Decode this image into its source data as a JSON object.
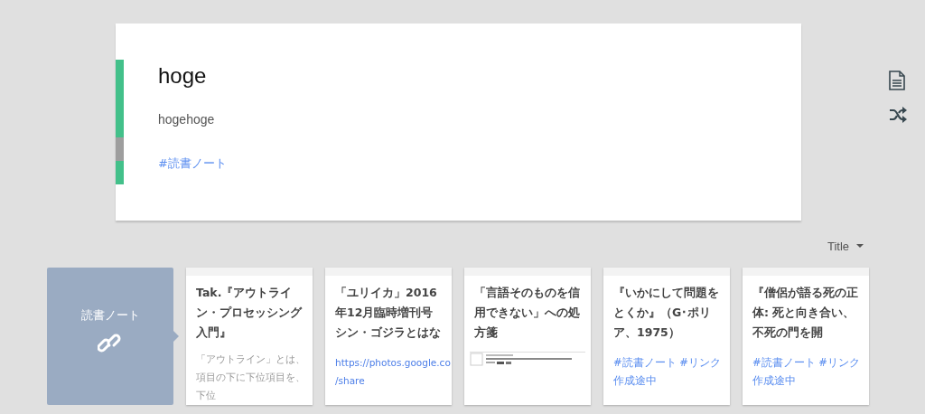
{
  "note": {
    "title": "hoge",
    "body": "hogehoge",
    "tags": [
      "#読書ノート"
    ]
  },
  "side_icons": [
    {
      "kind": "document"
    },
    {
      "kind": "shuffle"
    }
  ],
  "sort": {
    "label": "Title"
  },
  "tag_card": {
    "label": "読書ノート"
  },
  "cards": [
    {
      "title": "Tak.『アウトライン・プロセッシング入門』",
      "kind": "excerpt",
      "text": "「アウトライン」とは、項目の下に下位項目を、下位"
    },
    {
      "title": "「ユリイカ」2016年12月臨時増刊号シン・ゴジラとはな",
      "kind": "link",
      "url_lines": [
        "https://photos.google.co",
        "/share"
      ]
    },
    {
      "title": "「言語そのものを信用できない」への処方箋",
      "kind": "thumbnail"
    },
    {
      "title": "『いかにして問題をとくか』（G･ポリア、1975）",
      "kind": "tags",
      "tags": [
        "#読書ノート",
        "#リンク作成途中"
      ]
    },
    {
      "title": "『僧侶が語る死の正体: 死と向き合い、不死の門を開",
      "kind": "tags",
      "tags": [
        "#読書ノート",
        "#リンク作成途中"
      ]
    }
  ]
}
